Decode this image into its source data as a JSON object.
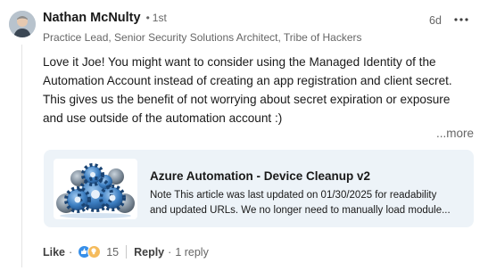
{
  "comment": {
    "author": {
      "name": "Nathan McNulty",
      "degree": "1st",
      "headline": "Practice Lead, Senior Security Solutions Architect, Tribe of Hackers"
    },
    "timestamp": "6d",
    "body_lines": [
      "Love it Joe! You might want to consider using the Managed Identity of the",
      "Automation Account instead of creating an app registration and client secret.",
      "This gives us the benefit of not worrying about secret expiration or exposure",
      "and use outside of the automation account :)"
    ],
    "more_label": "...more",
    "link_card": {
      "title": "Azure Automation - Device Cleanup v2",
      "description_lines": [
        "Note This article was last updated on 01/30/2025 for readability",
        "and updated URLs. We no longer need to manually load module..."
      ],
      "thumbnail_icon": "gears-icon"
    },
    "actions": {
      "like_label": "Like",
      "reaction_icons": [
        "like-reaction-icon",
        "insightful-reaction-icon"
      ],
      "reaction_count": "15",
      "reply_label": "Reply",
      "reply_count": "1 reply"
    },
    "colors": {
      "like_blue": "#378fe9",
      "insightful_yellow": "#f5bb5c",
      "card_bg": "#edf3f8"
    }
  }
}
